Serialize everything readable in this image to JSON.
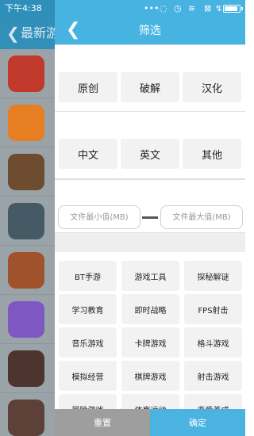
{
  "status_bar": {
    "time": "下午4:38"
  },
  "background": {
    "title": "最新游",
    "back_glyph": "❮",
    "thumbs": [
      "#c0392b",
      "#e67e22",
      "#6d4c2f",
      "#455a64",
      "#a0522d",
      "#7e57c2",
      "#4e342e",
      "#5d4037"
    ]
  },
  "header": {
    "title": "筛选",
    "back_glyph": "❮"
  },
  "origin_options": [
    "原创",
    "破解",
    "汉化"
  ],
  "language_options": [
    "中文",
    "英文",
    "其他"
  ],
  "size_filter": {
    "min_placeholder": "文件最小值(MB)",
    "max_placeholder": "文件最大值(MB)"
  },
  "game_types": [
    "BT手游",
    "游戏工具",
    "探秘解谜",
    "学习教育",
    "即时战略",
    "FPS射击",
    "音乐游戏",
    "卡牌游戏",
    "格斗游戏",
    "模拟经营",
    "棋牌游戏",
    "射击游戏",
    "冒险游戏",
    "体育运动",
    "恋爱养成"
  ],
  "buttons": {
    "reset": "重置",
    "confirm": "确定"
  },
  "battery_level": 0.9,
  "colors": {
    "accent": "#46b3e0",
    "reset_bg": "#9e9e9e",
    "confirm_bg": "#4ab3e0"
  }
}
